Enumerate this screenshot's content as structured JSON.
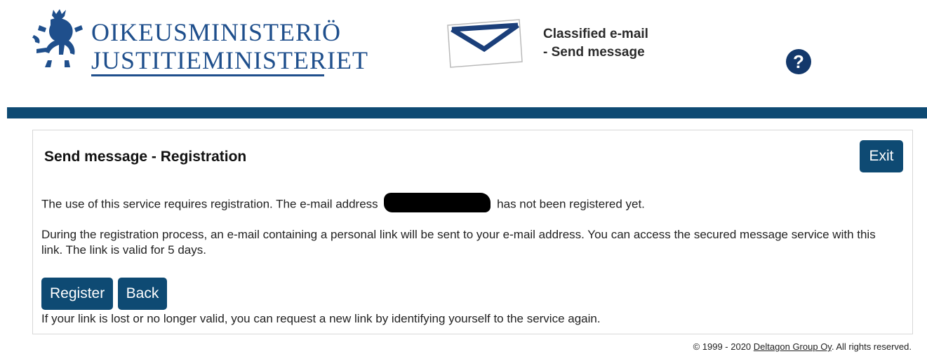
{
  "header": {
    "logo": {
      "line1": "OIKEUSMINISTERIÖ",
      "line2": "JUSTITIEMINISTERIET",
      "icon": "heraldic-lion-icon"
    },
    "app_title_line1": "Classified e-mail",
    "app_title_line2": "- Send message",
    "envelope_icon": "envelope-icon",
    "help_label": "?"
  },
  "colors": {
    "brand_dark_blue": "#0e4a73",
    "logo_blue": "#1f4f8c",
    "help_navy": "#13386b"
  },
  "panel": {
    "title": "Send message - Registration",
    "exit_label": "Exit",
    "intro_before": "The use of this service requires registration. The e-mail address",
    "intro_after": "has not been registered yet.",
    "info": "During the registration process, an e-mail containing a personal link will be sent to your e-mail address. You can access the secured message service with this link. The link is valid for 5 days.",
    "register_label": "Register",
    "back_label": "Back",
    "lost_link_note": "If your link is lost or no longer valid, you can request a new link by identifying yourself to the service again."
  },
  "footer": {
    "prefix": "© 1999 - 2020",
    "company": "Deltagon Group Oy",
    "suffix": ". All rights reserved."
  }
}
